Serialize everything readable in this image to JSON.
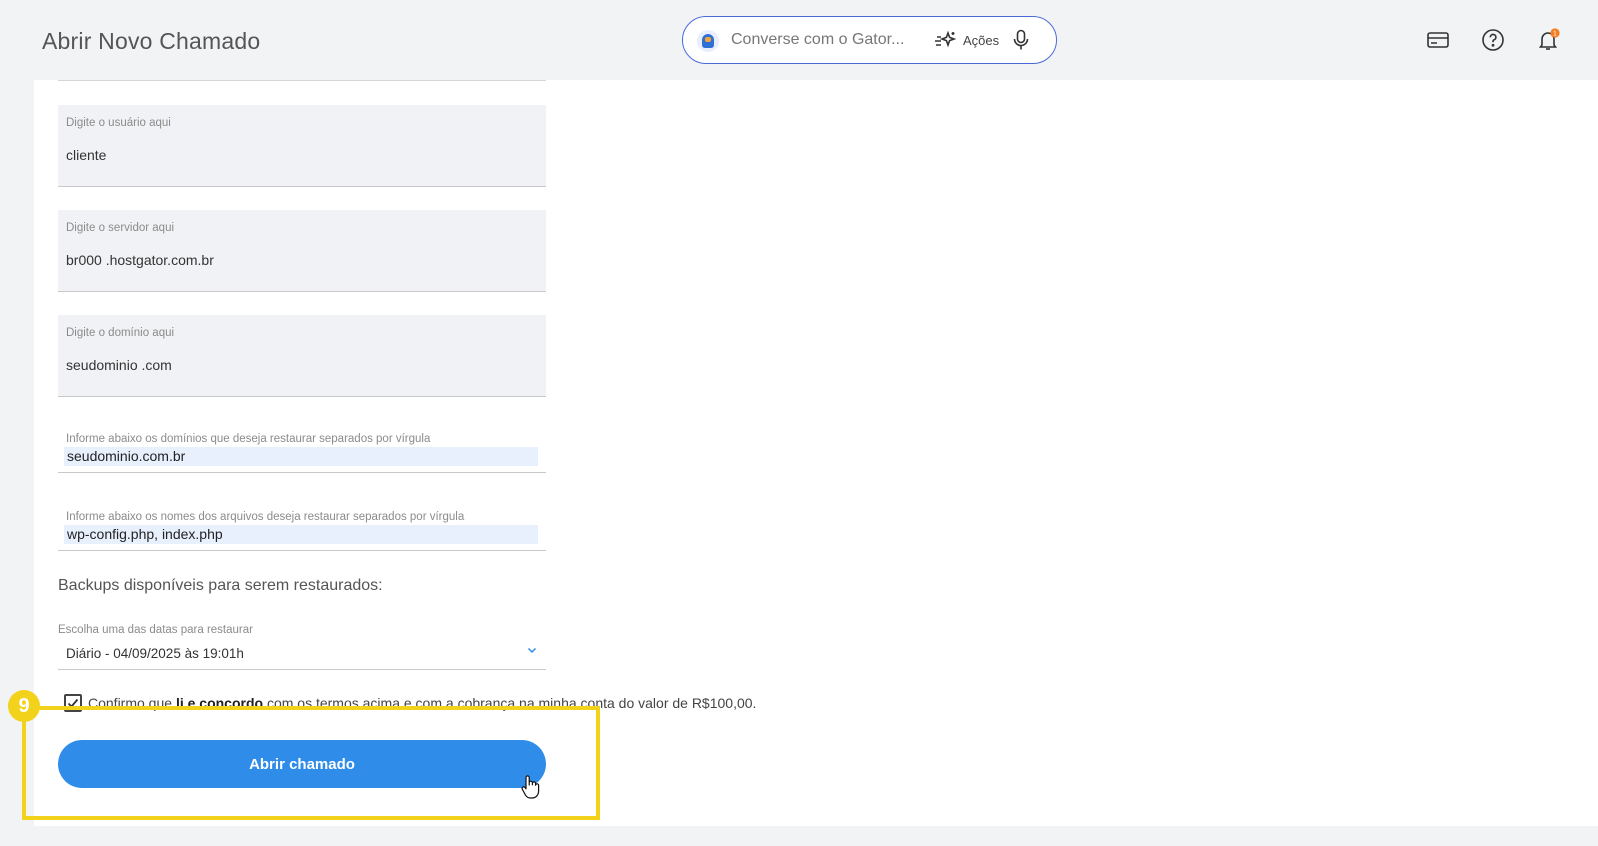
{
  "header": {
    "title": "Abrir Novo Chamado",
    "assistant": {
      "placeholder": "Converse com o Gator...",
      "actions_label": "Ações",
      "icons": [
        "gator-avatar-icon",
        "sparkle-actions-icon",
        "microphone-icon"
      ]
    },
    "right_icons": [
      "billing-card-icon",
      "help-icon",
      "notification-bell-icon"
    ],
    "notification_count": "1"
  },
  "form": {
    "user_field": {
      "label": "Digite o usuário aqui",
      "value": "cliente"
    },
    "server_field": {
      "label": "Digite o servidor aqui",
      "value": "br000 .hostgator.com.br"
    },
    "domain_field": {
      "label": "Digite o domínio aqui",
      "value": "seudominio .com"
    },
    "domains_restore": {
      "label": "Informe abaixo os domínios que deseja restaurar separados por vírgula",
      "value": "seudominio.com.br"
    },
    "files_restore": {
      "label": "Informe abaixo os nomes dos arquivos deseja restaurar separados por vírgula",
      "value": "wp-config.php, index.php"
    },
    "backups_title": "Backups disponíveis para serem restaurados:",
    "date_select": {
      "label": "Escolha uma das datas para restaurar",
      "value": "Diário - 04/09/2025 às 19:01h"
    },
    "confirm": {
      "checked": true,
      "before": "Confirmo que ",
      "bold": "li e concordo",
      "after": " com os termos acima e com a cobrança na minha conta do valor de R$100,00."
    },
    "submit_label": "Abrir chamado"
  },
  "annotation": {
    "step": "9",
    "color": "#f2d21b"
  },
  "colors": {
    "primary": "#2f8de9",
    "assistant_border": "#4a6ad8",
    "badge": "#f47b20"
  }
}
